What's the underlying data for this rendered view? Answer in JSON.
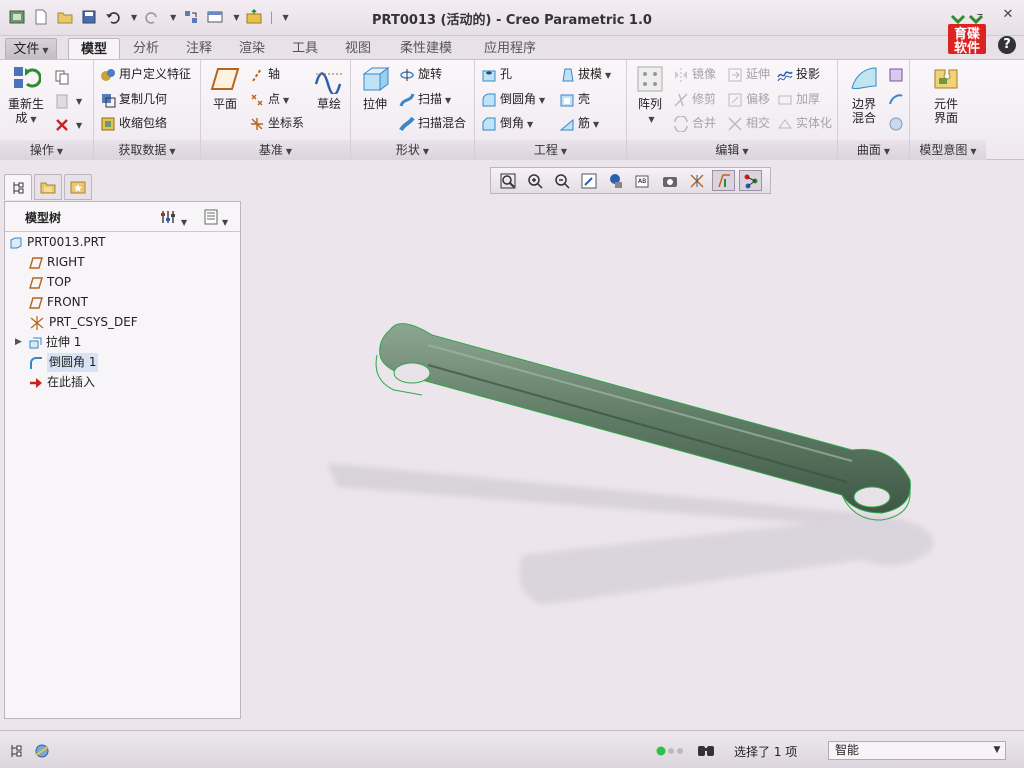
{
  "window": {
    "title": "PRT0013 (活动的) - Creo Parametric 1.0",
    "logo_text": "育碟软件"
  },
  "quick_access": [
    "app-icon",
    "new-icon",
    "open-icon",
    "save-icon",
    "undo-icon",
    "redo-icon",
    "regenerate-icon",
    "windows-icon",
    "close-window-icon",
    "customize-icon"
  ],
  "tabs": [
    {
      "label": "文件",
      "key": "file"
    },
    {
      "label": "模型",
      "key": "model",
      "active": true
    },
    {
      "label": "分析",
      "key": "analysis"
    },
    {
      "label": "注释",
      "key": "annotate"
    },
    {
      "label": "渲染",
      "key": "render"
    },
    {
      "label": "工具",
      "key": "tools"
    },
    {
      "label": "视图",
      "key": "view"
    },
    {
      "label": "柔性建模",
      "key": "flexible"
    },
    {
      "label": "应用程序",
      "key": "apps"
    }
  ],
  "ribbon": {
    "operations": {
      "regenerate_l1": "重新生",
      "regenerate_l2": "成",
      "group": "操作"
    },
    "get_data": {
      "udf": "用户定义特征",
      "copy_geom": "复制几何",
      "shrinkwrap": "收缩包络",
      "group": "获取数据"
    },
    "datum": {
      "plane": "平面",
      "axis": "轴",
      "point": "点",
      "csys": "坐标系",
      "sketch": "草绘",
      "group": "基准"
    },
    "shapes": {
      "extrude": "拉伸",
      "revolve": "旋转",
      "sweep": "扫描",
      "swept_blend": "扫描混合",
      "group": "形状"
    },
    "engineering": {
      "hole": "孔",
      "round": "倒圆角",
      "chamfer": "倒角",
      "draft": "拔模",
      "shell": "壳",
      "rib": "筋",
      "group": "工程"
    },
    "editing": {
      "pattern": "阵列",
      "mirror": "镜像",
      "trim": "修剪",
      "merge": "合并",
      "extend": "延伸",
      "offset": "偏移",
      "intersect": "相交",
      "project": "投影",
      "thicken": "加厚",
      "solidify": "实体化",
      "group": "编辑"
    },
    "surfaces": {
      "boundary_l1": "边界",
      "boundary_l2": "混合",
      "group": "曲面"
    },
    "model_intent": {
      "component_l1": "元件",
      "component_l2": "界面",
      "group": "模型意图"
    }
  },
  "model_tree": {
    "title": "模型树",
    "items": [
      {
        "label": "PRT0013.PRT",
        "icon": "part-icon"
      },
      {
        "label": "RIGHT",
        "icon": "datum-plane-icon"
      },
      {
        "label": "TOP",
        "icon": "datum-plane-icon"
      },
      {
        "label": "FRONT",
        "icon": "datum-plane-icon"
      },
      {
        "label": "PRT_CSYS_DEF",
        "icon": "csys-icon"
      },
      {
        "label": "拉伸 1",
        "icon": "extrude-icon"
      },
      {
        "label": "倒圆角 1",
        "icon": "round-icon",
        "selected": true
      },
      {
        "label": "在此插入",
        "icon": "insert-here-arrow-icon"
      }
    ]
  },
  "view_toolbar": [
    "refit-icon",
    "zoom-in-icon",
    "zoom-out-icon",
    "repaint-icon",
    "display-style-icon",
    "saved-orientations-icon",
    "view-manager-icon",
    "spin-center-icon",
    "datum-display-icon",
    "annotation-display-icon"
  ],
  "status": {
    "selection": "选择了 1 项",
    "filter": "智能"
  },
  "colors": {
    "accent": "#4f8a5b",
    "model": "#5d7a63",
    "shadow": "#c9c2cb"
  }
}
